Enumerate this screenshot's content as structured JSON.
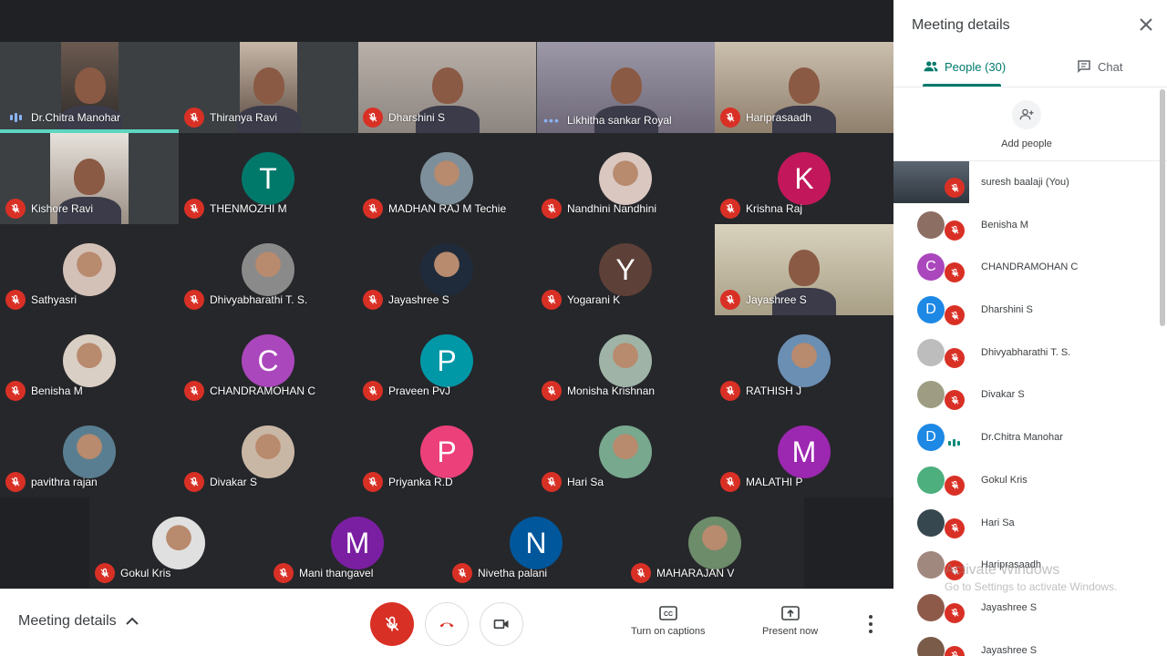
{
  "grid": {
    "tiles": [
      {
        "name": "Dr.Chitra Manohar",
        "kind": "camera",
        "status": "speaking"
      },
      {
        "name": "Thiranya Ravi",
        "kind": "camera",
        "status": "muted"
      },
      {
        "name": "Dharshini S",
        "kind": "camera",
        "status": "muted"
      },
      {
        "name": "Likhitha sankar Royal",
        "kind": "camera",
        "status": "more"
      },
      {
        "name": "Hariprasaadh",
        "kind": "camera",
        "status": "muted"
      },
      {
        "name": "Kishore Ravi",
        "kind": "camera",
        "status": "muted"
      },
      {
        "name": "THENMOZHI M",
        "kind": "letter",
        "letter": "T",
        "color": "#00796b",
        "status": "muted"
      },
      {
        "name": "MADHAN RAJ M Techie",
        "kind": "photo",
        "status": "muted"
      },
      {
        "name": "Nandhini Nandhini",
        "kind": "photo",
        "status": "muted"
      },
      {
        "name": "Krishna Raj",
        "kind": "letter",
        "letter": "K",
        "color": "#c2185b",
        "status": "muted"
      },
      {
        "name": "Sathyasri",
        "kind": "photo",
        "status": "muted"
      },
      {
        "name": "Dhivyabharathi T. S.",
        "kind": "photo",
        "status": "muted"
      },
      {
        "name": "Jayashree S",
        "kind": "photo",
        "status": "muted"
      },
      {
        "name": "Yogarani K",
        "kind": "letter",
        "letter": "Y",
        "color": "#5d4037",
        "status": "muted"
      },
      {
        "name": "Jayashree S",
        "kind": "camera",
        "status": "muted"
      },
      {
        "name": "Benisha M",
        "kind": "photo",
        "status": "muted"
      },
      {
        "name": "CHANDRAMOHAN C",
        "kind": "letter",
        "letter": "C",
        "color": "#ab47bc",
        "status": "muted"
      },
      {
        "name": "Praveen PvJ",
        "kind": "letter",
        "letter": "P",
        "color": "#0097a7",
        "status": "muted"
      },
      {
        "name": "Monisha Krishnan",
        "kind": "photo",
        "status": "muted"
      },
      {
        "name": "RATHISH J",
        "kind": "photo",
        "status": "muted"
      },
      {
        "name": "pavithra rajan",
        "kind": "photo",
        "status": "muted"
      },
      {
        "name": "Divakar S",
        "kind": "photo",
        "status": "muted"
      },
      {
        "name": "Priyanka R.D",
        "kind": "letter",
        "letter": "P",
        "color": "#ec407a",
        "status": "muted"
      },
      {
        "name": "Hari Sa",
        "kind": "photo",
        "status": "muted"
      },
      {
        "name": "MALATHI P",
        "kind": "letter",
        "letter": "M",
        "color": "#9c27b0",
        "status": "muted"
      },
      {
        "name": "Gokul Kris",
        "kind": "photo",
        "status": "muted"
      },
      {
        "name": "Mani thangavel",
        "kind": "letter",
        "letter": "M",
        "color": "#7b1fa2",
        "status": "muted"
      },
      {
        "name": "Nivetha palani",
        "kind": "letter",
        "letter": "N",
        "color": "#01579b",
        "status": "muted"
      },
      {
        "name": "MAHARAJAN V",
        "kind": "photo",
        "status": "muted"
      }
    ]
  },
  "bottombar": {
    "meeting_details_label": "Meeting details",
    "captions_label": "Turn on captions",
    "present_label": "Present now"
  },
  "panel": {
    "title": "Meeting details",
    "tab_people": "People (30)",
    "tab_chat": "Chat",
    "add_people_label": "Add people",
    "participants": [
      {
        "name": "suresh baalaji (You)",
        "kind": "self",
        "status": "muted"
      },
      {
        "name": "Benisha M",
        "kind": "photo",
        "color": "#8d6e63",
        "status": "muted"
      },
      {
        "name": "CHANDRAMOHAN C",
        "kind": "letter",
        "letter": "C",
        "color": "#ab47bc",
        "status": "muted"
      },
      {
        "name": "Dharshini S",
        "kind": "letter",
        "letter": "D",
        "color": "#1e88e5",
        "status": "muted"
      },
      {
        "name": "Dhivyabharathi T. S.",
        "kind": "photo",
        "color": "#bdbdbd",
        "status": "muted"
      },
      {
        "name": "Divakar S",
        "kind": "photo",
        "color": "#9e9d83",
        "status": "muted"
      },
      {
        "name": "Dr.Chitra Manohar",
        "kind": "letter",
        "letter": "D",
        "color": "#1e88e5",
        "status": "speaking"
      },
      {
        "name": "Gokul Kris",
        "kind": "photo",
        "color": "#4caf7d",
        "status": "muted"
      },
      {
        "name": "Hari Sa",
        "kind": "photo",
        "color": "#37474f",
        "status": "muted"
      },
      {
        "name": "Hariprasaadh",
        "kind": "photo",
        "color": "#a1887f",
        "status": "muted"
      },
      {
        "name": "Jayashree S",
        "kind": "photo",
        "color": "#8d5a4a",
        "status": "muted"
      },
      {
        "name": "Jayashree S",
        "kind": "photo",
        "color": "#7a5a48",
        "status": "muted"
      }
    ]
  },
  "watermark": {
    "line1": "Activate Windows",
    "line2": "Go to Settings to activate Windows."
  }
}
